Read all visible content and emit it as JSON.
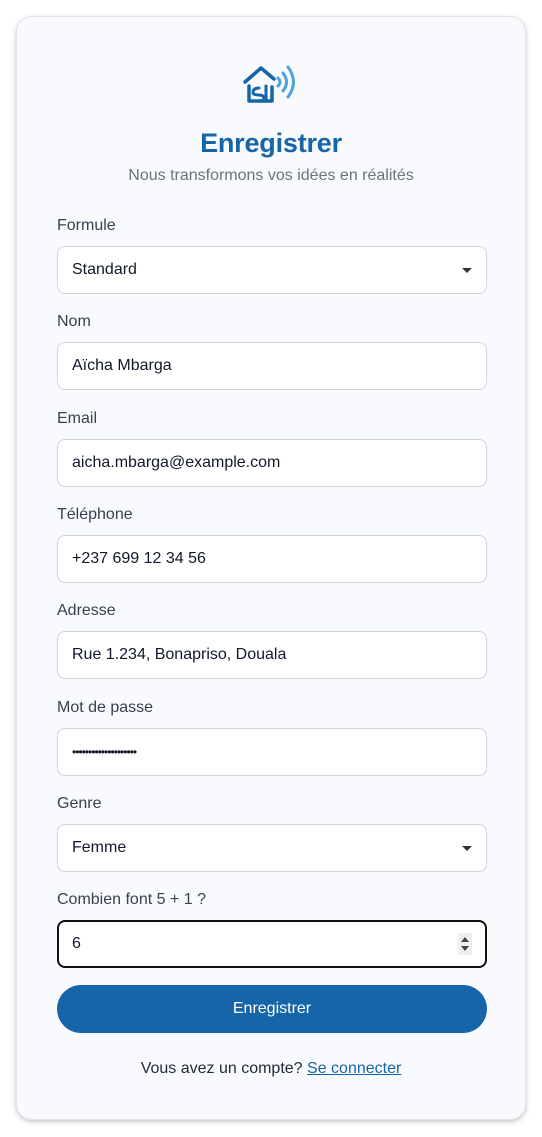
{
  "header": {
    "logo_icon": "smart-home-icon",
    "title": "Enregistrer",
    "subtitle": "Nous transformons vos idées en réalités"
  },
  "form": {
    "formule": {
      "label": "Formule",
      "value": "Standard"
    },
    "nom": {
      "label": "Nom",
      "value": "Aïcha Mbarga"
    },
    "email": {
      "label": "Email",
      "value": "aicha.mbarga@example.com"
    },
    "telephone": {
      "label": "Téléphone",
      "value": "+237 699 12 34 56"
    },
    "adresse": {
      "label": "Adresse",
      "value": "Rue 1.234, Bonapriso, Douala"
    },
    "password": {
      "label": "Mot de passe",
      "masked_value": "••••••••••••••••••••"
    },
    "genre": {
      "label": "Genre",
      "value": "Femme"
    },
    "captcha": {
      "label": "Combien font 5 + 1 ?",
      "value": "6"
    },
    "submit_label": "Enregistrer"
  },
  "footer": {
    "prompt": "Vous avez un compte?",
    "link_label": "Se connecter"
  },
  "colors": {
    "accent": "#1565a8",
    "card_background": "#f9fafd",
    "text_muted": "#6b7280"
  }
}
